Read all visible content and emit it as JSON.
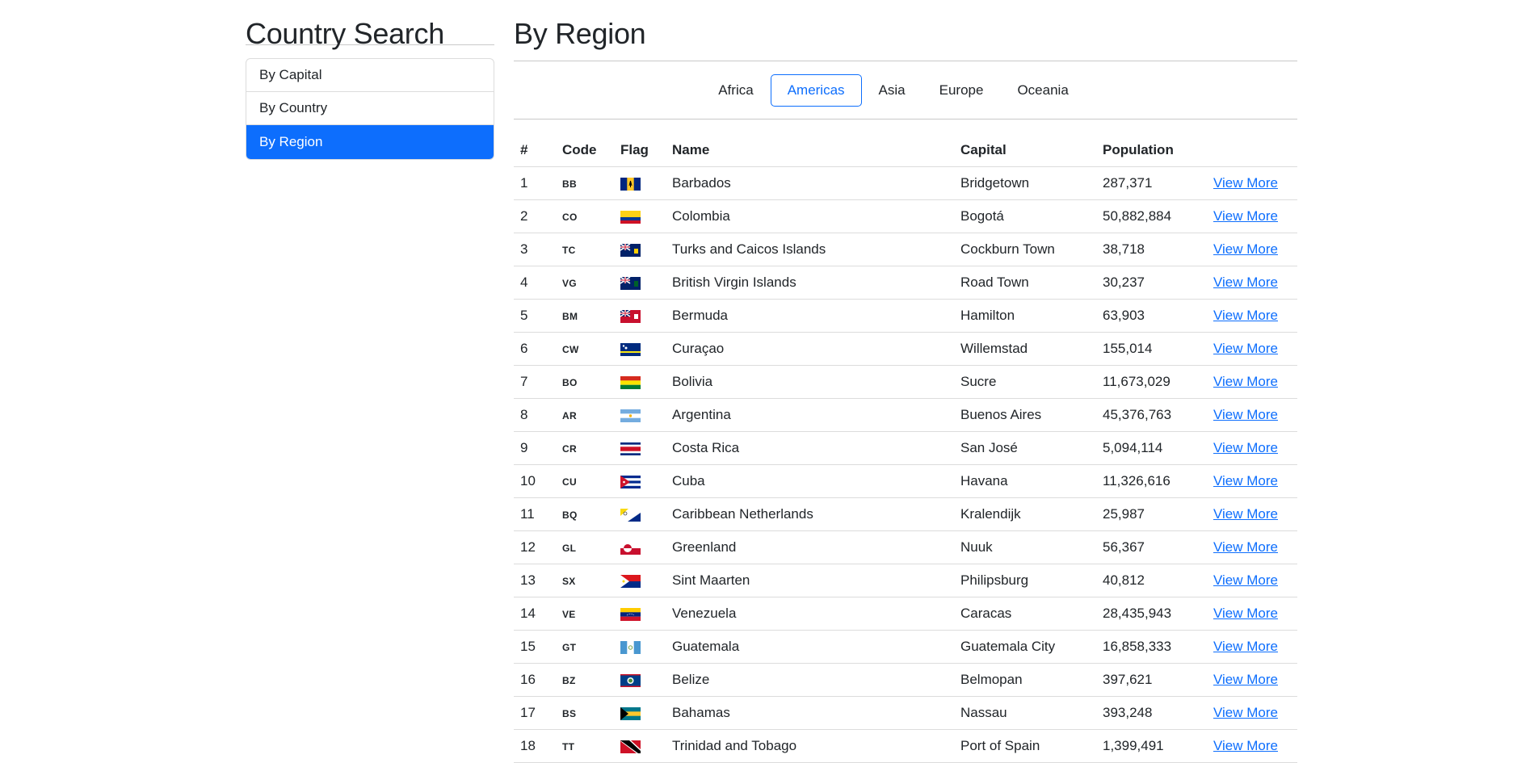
{
  "sidebar": {
    "title": "Country Search",
    "menu": [
      {
        "label": "By Capital",
        "active": false
      },
      {
        "label": "By Country",
        "active": false
      },
      {
        "label": "By Region",
        "active": true
      }
    ]
  },
  "main": {
    "title": "By Region",
    "regions": [
      {
        "label": "Africa",
        "active": false
      },
      {
        "label": "Americas",
        "active": true
      },
      {
        "label": "Asia",
        "active": false
      },
      {
        "label": "Europe",
        "active": false
      },
      {
        "label": "Oceania",
        "active": false
      }
    ],
    "table": {
      "headers": [
        "#",
        "Code",
        "Flag",
        "Name",
        "Capital",
        "Population",
        ""
      ],
      "link_label": "View More",
      "rows": [
        {
          "num": "1",
          "code": "BB",
          "flag": "flag-barbados",
          "name": "Barbados",
          "capital": "Bridgetown",
          "population": "287,371"
        },
        {
          "num": "2",
          "code": "CO",
          "flag": "flag-colombia",
          "name": "Colombia",
          "capital": "Bogotá",
          "population": "50,882,884"
        },
        {
          "num": "3",
          "code": "TC",
          "flag": "flag-turks-and-caicos",
          "name": "Turks and Caicos Islands",
          "capital": "Cockburn Town",
          "population": "38,718"
        },
        {
          "num": "4",
          "code": "VG",
          "flag": "flag-british-virgin-islands",
          "name": "British Virgin Islands",
          "capital": "Road Town",
          "population": "30,237"
        },
        {
          "num": "5",
          "code": "BM",
          "flag": "flag-bermuda",
          "name": "Bermuda",
          "capital": "Hamilton",
          "population": "63,903"
        },
        {
          "num": "6",
          "code": "CW",
          "flag": "flag-curacao",
          "name": "Curaçao",
          "capital": "Willemstad",
          "population": "155,014"
        },
        {
          "num": "7",
          "code": "BO",
          "flag": "flag-bolivia",
          "name": "Bolivia",
          "capital": "Sucre",
          "population": "11,673,029"
        },
        {
          "num": "8",
          "code": "AR",
          "flag": "flag-argentina",
          "name": "Argentina",
          "capital": "Buenos Aires",
          "population": "45,376,763"
        },
        {
          "num": "9",
          "code": "CR",
          "flag": "flag-costa-rica",
          "name": "Costa Rica",
          "capital": "San José",
          "population": "5,094,114"
        },
        {
          "num": "10",
          "code": "CU",
          "flag": "flag-cuba",
          "name": "Cuba",
          "capital": "Havana",
          "population": "11,326,616"
        },
        {
          "num": "11",
          "code": "BQ",
          "flag": "flag-caribbean-netherlands",
          "name": "Caribbean Netherlands",
          "capital": "Kralendijk",
          "population": "25,987"
        },
        {
          "num": "12",
          "code": "GL",
          "flag": "flag-greenland",
          "name": "Greenland",
          "capital": "Nuuk",
          "population": "56,367"
        },
        {
          "num": "13",
          "code": "SX",
          "flag": "flag-sint-maarten",
          "name": "Sint Maarten",
          "capital": "Philipsburg",
          "population": "40,812"
        },
        {
          "num": "14",
          "code": "VE",
          "flag": "flag-venezuela",
          "name": "Venezuela",
          "capital": "Caracas",
          "population": "28,435,943"
        },
        {
          "num": "15",
          "code": "GT",
          "flag": "flag-guatemala",
          "name": "Guatemala",
          "capital": "Guatemala City",
          "population": "16,858,333"
        },
        {
          "num": "16",
          "code": "BZ",
          "flag": "flag-belize",
          "name": "Belize",
          "capital": "Belmopan",
          "population": "397,621"
        },
        {
          "num": "17",
          "code": "BS",
          "flag": "flag-bahamas",
          "name": "Bahamas",
          "capital": "Nassau",
          "population": "393,248"
        },
        {
          "num": "18",
          "code": "TT",
          "flag": "flag-trinidad-and-tobago",
          "name": "Trinidad and Tobago",
          "capital": "Port of Spain",
          "population": "1,399,491"
        }
      ]
    }
  }
}
